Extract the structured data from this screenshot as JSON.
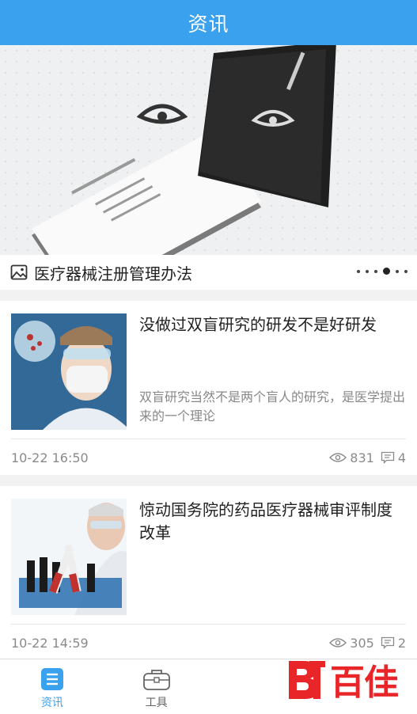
{
  "header": {
    "title": "资讯"
  },
  "banner": {
    "caption": "医疗器械注册管理办法",
    "slide_count": 6,
    "active_slide": 4
  },
  "articles": [
    {
      "title": "没做过双盲研究的研发不是好研发",
      "summary": "双盲研究当然不是两个盲人的研究，是医学提出来的一个理论",
      "time": "10-22 16:50",
      "views": "831",
      "comments": "4"
    },
    {
      "title": "惊动国务院的药品医疗器械审评制度改革",
      "summary": "",
      "time": "10-22 14:59",
      "views": "305",
      "comments": "2"
    }
  ],
  "tabbar": {
    "tabs": [
      {
        "label": "资讯",
        "icon": "news-icon",
        "active": true
      },
      {
        "label": "工具",
        "icon": "toolbox-icon",
        "active": false
      },
      {
        "label": "",
        "icon": "",
        "active": false
      },
      {
        "label": "",
        "icon": "",
        "active": false
      }
    ]
  },
  "watermark": {
    "text": "百佳"
  },
  "colors": {
    "accent": "#3aa1ee",
    "watermark": "#e8262a"
  }
}
